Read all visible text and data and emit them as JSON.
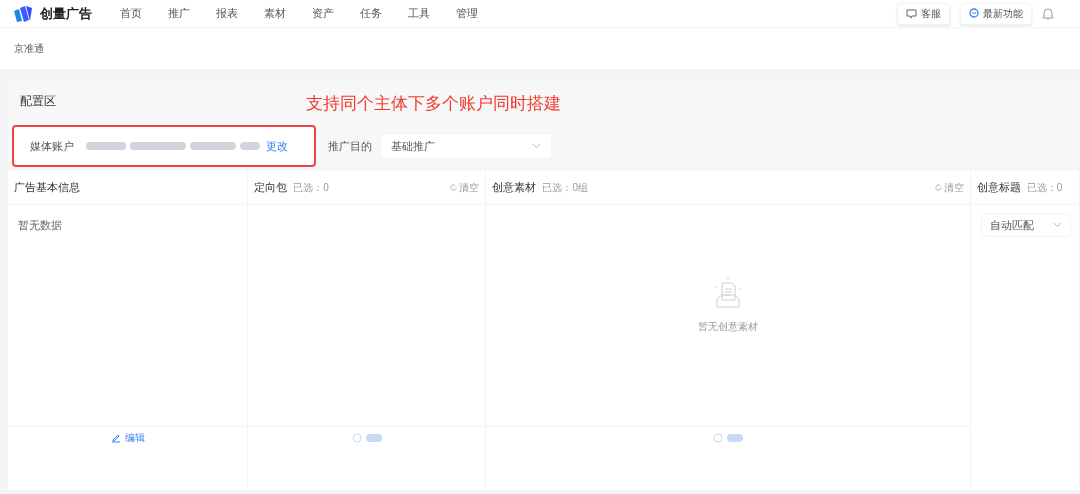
{
  "nav": {
    "logo": "创量广告",
    "items": [
      {
        "label": "首页",
        "selected": false
      },
      {
        "label": "推广",
        "selected": false
      },
      {
        "label": "报表",
        "selected": false
      },
      {
        "label": "素材",
        "selected": false
      },
      {
        "label": "资产",
        "selected": false
      },
      {
        "label": "任务",
        "selected": false
      },
      {
        "label": "工具",
        "selected": false
      },
      {
        "label": "管理",
        "selected": false
      }
    ],
    "service": "客服",
    "whats_new": "最新功能"
  },
  "breadcrumb": "京准通",
  "config": {
    "title": "配置区",
    "annotation": "支持同个主体下多个账户同时搭建",
    "account_label": "媒体账户",
    "change_link": "更改",
    "goal_label": "推广目的",
    "goal_value": "基础推广"
  },
  "columns": [
    {
      "kind": "info",
      "title": "广告基本信息",
      "empty_text": "暂无数据",
      "footer": "编辑",
      "footer_disabled": false
    },
    {
      "kind": "targeting",
      "title": "定向包",
      "count": "已选：0",
      "clear": "清空",
      "footer_disabled": true
    },
    {
      "kind": "material",
      "title": "创意素材",
      "count": "已选：0组",
      "clear": "清空",
      "empty_text": "暂无创意素材",
      "footer_disabled": true
    },
    {
      "kind": "title",
      "title": "创意标题",
      "count": "已选：0",
      "select_value": "自动匹配"
    }
  ]
}
